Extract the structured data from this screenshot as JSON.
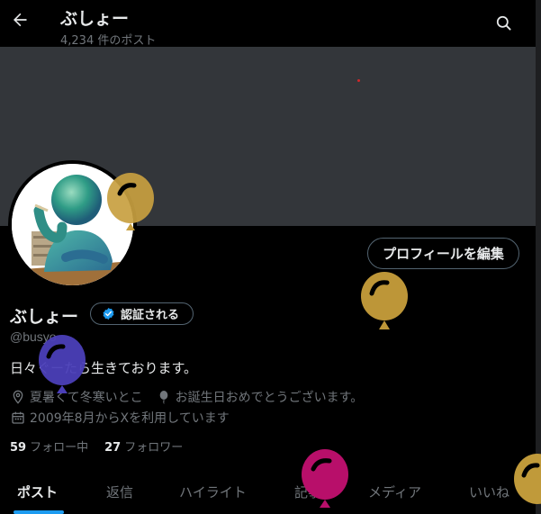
{
  "header": {
    "name": "ぶしょー",
    "post_count": "4,234 件のポスト",
    "back_icon": "arrow-left-icon",
    "search_icon": "search-icon"
  },
  "profile": {
    "edit_button": "プロフィールを編集",
    "name": "ぶしょー",
    "verify_label": "認証される",
    "handle": "@busyo",
    "bio": "日々ぐーたら生きております。",
    "location": "夏暑くて冬寒いとこ",
    "birthday": "お誕生日おめでとうございます。",
    "joined": "2009年8月からXを利用しています",
    "following_count": "59",
    "following_label": "フォロー中",
    "followers_count": "27",
    "followers_label": "フォロワー"
  },
  "tabs": [
    {
      "label": "ポスト",
      "active": true
    },
    {
      "label": "返信",
      "active": false
    },
    {
      "label": "ハイライト",
      "active": false
    },
    {
      "label": "記事",
      "active": false
    },
    {
      "label": "メディア",
      "active": false
    },
    {
      "label": "いいね",
      "active": false
    }
  ],
  "colors": {
    "accent": "#1d9bf0",
    "banner": "#33363a",
    "balloon_gold": "#c09a3a",
    "balloon_gold_light": "#d9b04a",
    "balloon_purple": "#5a4fc4",
    "balloon_magenta": "#c0126e"
  }
}
